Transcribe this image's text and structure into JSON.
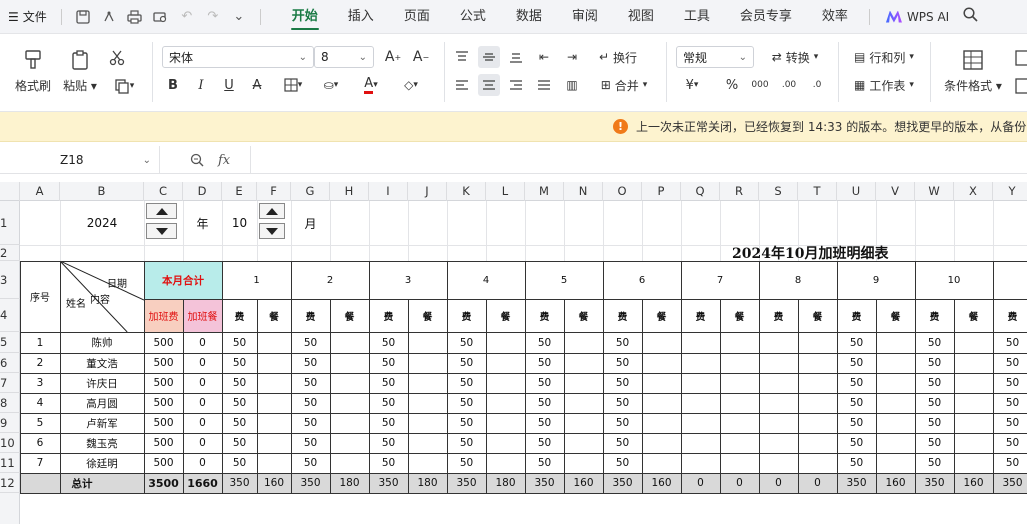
{
  "menubar": {
    "file_label": "文件",
    "tabs": [
      "开始",
      "插入",
      "页面",
      "公式",
      "数据",
      "审阅",
      "视图",
      "工具",
      "会员专享",
      "效率"
    ],
    "active_tab": "开始",
    "wps_ai": "WPS AI"
  },
  "ribbon": {
    "format_painter": "格式刷",
    "paste": "粘贴",
    "font_name": "宋体",
    "font_size": "8",
    "wrap": "换行",
    "merge": "合并",
    "number_format": "常规",
    "convert": "转换",
    "rows_cols": "行和列",
    "worksheet": "工作表",
    "cond_format": "条件格式",
    "bold": "B",
    "italic": "I",
    "underline": "U",
    "currency": "¥",
    "percent": "%"
  },
  "notification": {
    "text": "上一次未正常关闭，已经恢复到 14:33 的版本。想找更早的版本，从备份中"
  },
  "formula_bar": {
    "cell_ref": "Z18",
    "fx": "fx",
    "value": ""
  },
  "sheet": {
    "columns": [
      "A",
      "B",
      "C",
      "D",
      "E",
      "F",
      "G",
      "H",
      "I",
      "J",
      "K",
      "L",
      "M",
      "N",
      "O",
      "P",
      "Q",
      "R",
      "S",
      "T",
      "U",
      "V",
      "W",
      "X",
      "Y"
    ],
    "rows": [
      "1",
      "2",
      "3",
      "4",
      "5",
      "6",
      "7",
      "8",
      "9",
      "10",
      "11",
      "12"
    ],
    "year": "2024",
    "year_unit": "年",
    "month": "10",
    "month_unit": "月",
    "title": "2024年10月加班明细表",
    "hdr_seq": "序号",
    "hdr_date": "日期",
    "hdr_content": "内容",
    "hdr_name": "姓名",
    "hdr_month_total": "本月合计",
    "hdr_ot_fee": "加班费",
    "hdr_ot_meal": "加班餐",
    "hdr_fee": "费",
    "hdr_meal": "餐",
    "days": [
      "1",
      "2",
      "3",
      "4",
      "5",
      "6",
      "7",
      "8",
      "9",
      "10"
    ],
    "employees": [
      {
        "seq": "1",
        "name": "陈帅",
        "fee": "500",
        "meal": "0",
        "daily": [
          "50",
          "50",
          "50",
          "50",
          "50",
          "50",
          "",
          "",
          "50",
          "50",
          "50"
        ]
      },
      {
        "seq": "2",
        "name": "董文浩",
        "fee": "500",
        "meal": "0",
        "daily": [
          "50",
          "50",
          "50",
          "50",
          "50",
          "50",
          "",
          "",
          "50",
          "50",
          "50"
        ]
      },
      {
        "seq": "3",
        "name": "许庆日",
        "fee": "500",
        "meal": "0",
        "daily": [
          "50",
          "50",
          "50",
          "50",
          "50",
          "50",
          "",
          "",
          "50",
          "50",
          "50"
        ]
      },
      {
        "seq": "4",
        "name": "高月圆",
        "fee": "500",
        "meal": "0",
        "daily": [
          "50",
          "50",
          "50",
          "50",
          "50",
          "50",
          "",
          "",
          "50",
          "50",
          "50"
        ]
      },
      {
        "seq": "5",
        "name": "卢新军",
        "fee": "500",
        "meal": "0",
        "daily": [
          "50",
          "50",
          "50",
          "50",
          "50",
          "50",
          "",
          "",
          "50",
          "50",
          "50"
        ]
      },
      {
        "seq": "6",
        "name": "魏玉亮",
        "fee": "500",
        "meal": "0",
        "daily": [
          "50",
          "50",
          "50",
          "50",
          "50",
          "50",
          "",
          "",
          "50",
          "50",
          "50"
        ]
      },
      {
        "seq": "7",
        "name": "徐廷明",
        "fee": "500",
        "meal": "0",
        "daily": [
          "50",
          "50",
          "50",
          "50",
          "50",
          "50",
          "",
          "",
          "50",
          "50",
          "50"
        ]
      }
    ],
    "total_label": "总计",
    "total_fee": "3500",
    "total_meal": "1660",
    "totals": [
      "350",
      "160",
      "350",
      "180",
      "350",
      "180",
      "350",
      "180",
      "350",
      "160",
      "350",
      "160",
      "0",
      "0",
      "0",
      "0",
      "350",
      "160",
      "350",
      "160",
      "350"
    ],
    "colors": {
      "month_total_bg": "#b8ecea",
      "ot_fee_bg": "#f8cfc0",
      "ot_meal_bg": "#f4c3d9",
      "red_text": "#e01010",
      "total_bg": "#d9d9d9"
    }
  }
}
